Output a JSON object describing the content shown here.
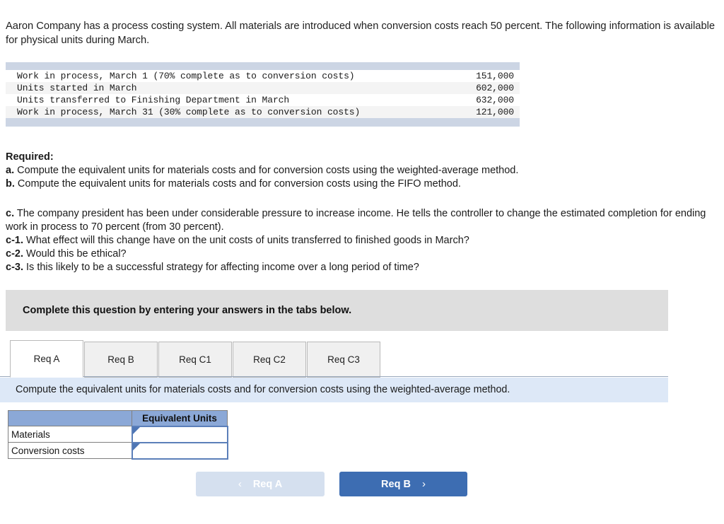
{
  "intro": {
    "text": "Aaron Company has a process costing system. All materials are introduced when conversion costs reach 50 percent. The following information is available for physical units during March."
  },
  "data_table": {
    "rows": [
      {
        "label": "Work in process, March 1 (70% complete as to conversion costs)",
        "amount": "151,000"
      },
      {
        "label": "Units started in March",
        "amount": "602,000"
      },
      {
        "label": "Units transferred to Finishing Department in March",
        "amount": "632,000"
      },
      {
        "label": "Work in process, March 31 (30% complete as to conversion costs)",
        "amount": "121,000"
      }
    ]
  },
  "required": {
    "heading": "Required:",
    "items": [
      {
        "marker": "a.",
        "text": "Compute the equivalent units for materials costs and for conversion costs using the weighted-average method."
      },
      {
        "marker": "b.",
        "text": "Compute the equivalent units for materials costs and for conversion costs using the FIFO method."
      }
    ]
  },
  "part_c": {
    "items": [
      {
        "marker": "c.",
        "text": "The company president has been under considerable pressure to increase income. He tells the controller to change the estimated completion for ending work in process to 70 percent (from 30 percent)."
      },
      {
        "marker": "c-1.",
        "text": "What effect will this change have on the unit costs of units transferred to finished goods in March?"
      },
      {
        "marker": "c-2.",
        "text": "Would this be ethical?"
      },
      {
        "marker": "c-3.",
        "text": "Is this likely to be a successful strategy for affecting income over a long period of time?"
      }
    ]
  },
  "banner": {
    "text": "Complete this question by entering your answers in the tabs below."
  },
  "tabs": {
    "items": [
      {
        "label": "Req A",
        "active": true
      },
      {
        "label": "Req B",
        "active": false
      },
      {
        "label": "Req C1",
        "active": false
      },
      {
        "label": "Req C2",
        "active": false
      },
      {
        "label": "Req C3",
        "active": false
      }
    ]
  },
  "instruction_bar": {
    "text": "Compute the equivalent units for materials costs and for conversion costs using the weighted-average method."
  },
  "answer_table": {
    "header_blank": "",
    "header_units": "Equivalent Units",
    "rows": [
      {
        "label": "Materials",
        "value": ""
      },
      {
        "label": "Conversion costs",
        "value": ""
      }
    ]
  },
  "nav": {
    "prev_label": "Req A",
    "prev_chevron": "‹",
    "next_label": "Req B",
    "next_chevron": "›"
  },
  "colors": {
    "table_bar": "#ccd5e4",
    "banner_gray": "#dedede",
    "instruction_blue": "#dde8f7",
    "header_blue": "#8ba8d7",
    "accent_blue": "#3d6db2",
    "disabled_blue": "#d5e0ef"
  }
}
